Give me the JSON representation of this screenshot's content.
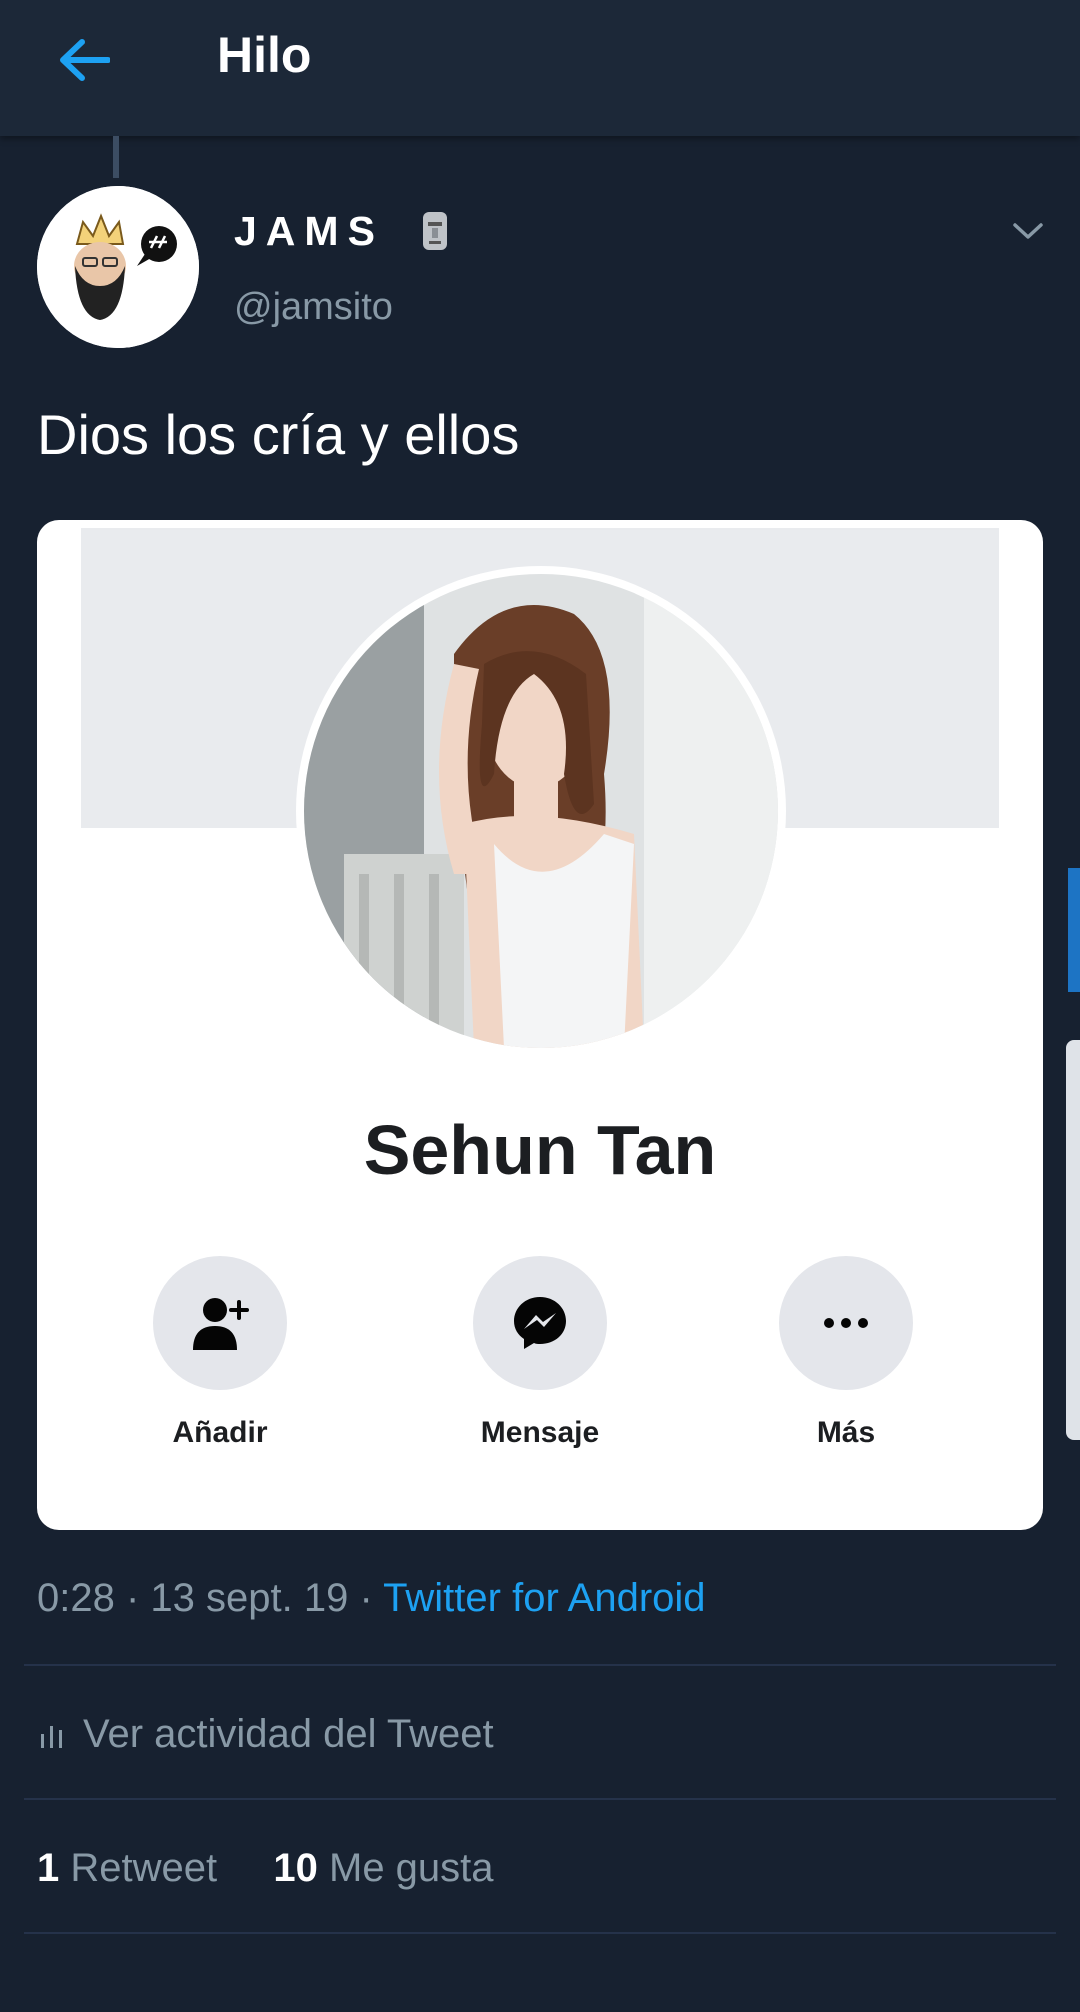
{
  "header": {
    "title": "Hilo"
  },
  "tweet": {
    "display_name": "JAMS",
    "handle": "@jamsito",
    "text": "Dios los cría y ellos",
    "time": "0:28",
    "separator": " · ",
    "date": "13 sept. 19",
    "source": "Twitter for Android",
    "activity_label": "Ver actividad del Tweet",
    "retweet_count": "1",
    "retweet_label": "Retweet",
    "like_count": "10",
    "like_label": "Me gusta"
  },
  "card": {
    "profile_name": "Sehun Tan",
    "actions": [
      {
        "label": "Añadir",
        "icon": "add-friend-icon"
      },
      {
        "label": "Mensaje",
        "icon": "messenger-icon"
      },
      {
        "label": "Más",
        "icon": "more-icon"
      }
    ]
  },
  "colors": {
    "background": "#172130",
    "topbar": "#1c2838",
    "accent": "#1da1f2",
    "secondary_text": "#8899a6"
  }
}
